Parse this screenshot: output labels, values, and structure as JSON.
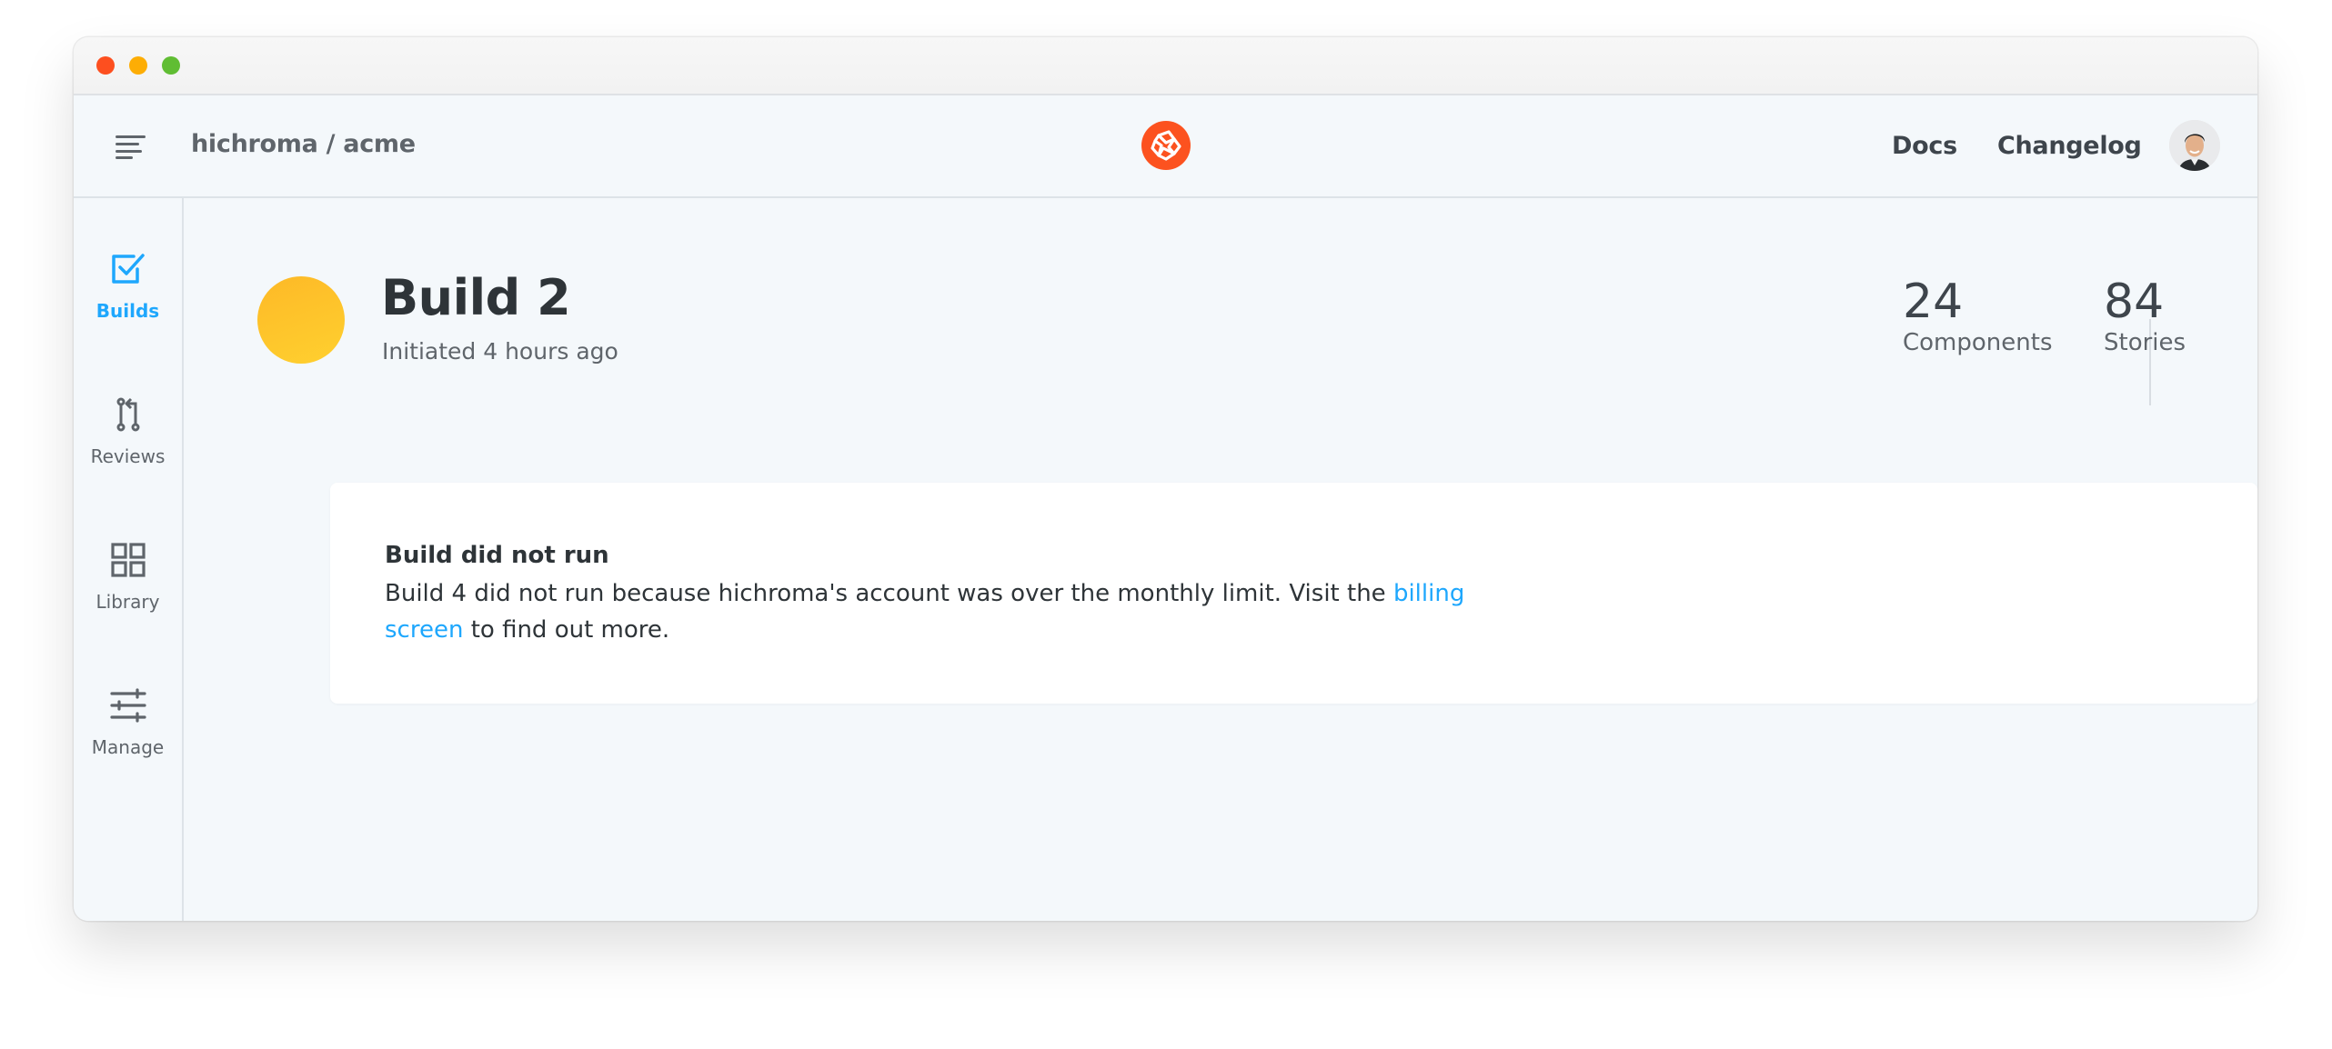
{
  "window": {
    "traffic_lights": [
      "close",
      "minimize",
      "maximize"
    ]
  },
  "header": {
    "menu_icon": "hamburger-icon",
    "breadcrumb": "hichroma / acme",
    "logo_icon": "chromatic-logo-icon",
    "nav": [
      {
        "label": "Docs"
      },
      {
        "label": "Changelog"
      }
    ],
    "avatar_alt": "user avatar"
  },
  "sidebar": {
    "items": [
      {
        "label": "Builds",
        "icon": "checkbox-icon",
        "active": true
      },
      {
        "label": "Reviews",
        "icon": "pull-request-icon",
        "active": false
      },
      {
        "label": "Library",
        "icon": "grid-icon",
        "active": false
      },
      {
        "label": "Manage",
        "icon": "sliders-icon",
        "active": false
      }
    ]
  },
  "build": {
    "title": "Build 2",
    "subtitle": "Initiated 4 hours ago",
    "status": "pending",
    "status_color": "#FDBF2D",
    "stats": [
      {
        "value": "24",
        "label": "Components"
      },
      {
        "value": "84",
        "label": "Stories"
      }
    ]
  },
  "notice": {
    "title": "Build did not run",
    "body_before": "Build 4 did not run because hichroma's account was over the monthly limit. Visit the ",
    "link_text": "billing screen",
    "body_after": " to find out more."
  },
  "colors": {
    "accent": "#1EA7FD",
    "brand": "#FC521F",
    "text": "#2E3438",
    "muted": "#5F656B"
  }
}
